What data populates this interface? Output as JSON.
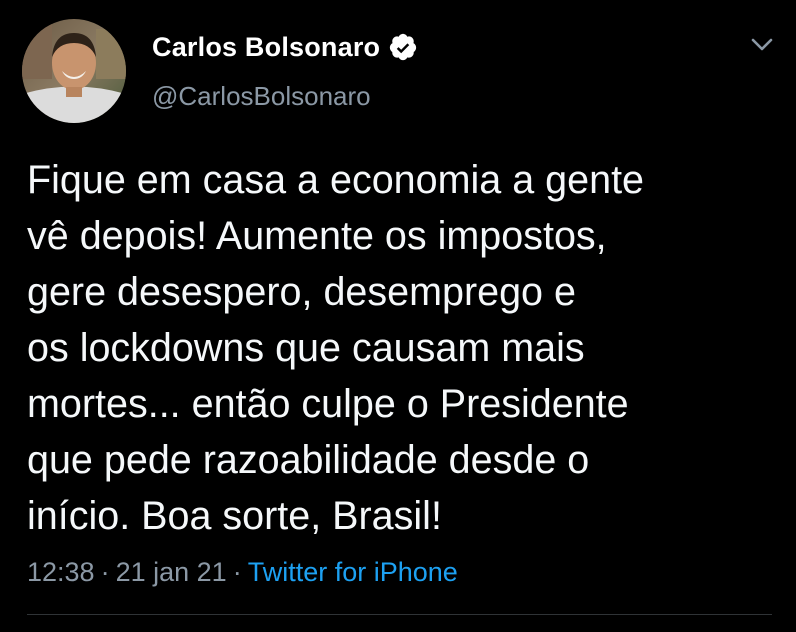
{
  "author": {
    "name": "Carlos Bolsonaro",
    "handle": "@CarlosBolsonaro",
    "verified": true
  },
  "tweet": {
    "lines": [
      "Fique em casa a economia a gente",
      "vê depois! Aumente os impostos,",
      "gere desespero, desemprego e",
      "os lockdowns que causam mais",
      "mortes... então culpe o Presidente",
      "que pede razoabilidade desde o",
      "início. Boa sorte, Brasil!"
    ]
  },
  "meta": {
    "time": "12:38",
    "separator": "·",
    "date": "21 jan 21",
    "source": "Twitter for iPhone"
  },
  "icons": {
    "verified": "verified-badge-icon",
    "menu": "chevron-down-icon"
  },
  "colors": {
    "background": "#000000",
    "text": "#f5f8fa",
    "secondary": "#8b98a5",
    "link": "#1da1f2"
  }
}
